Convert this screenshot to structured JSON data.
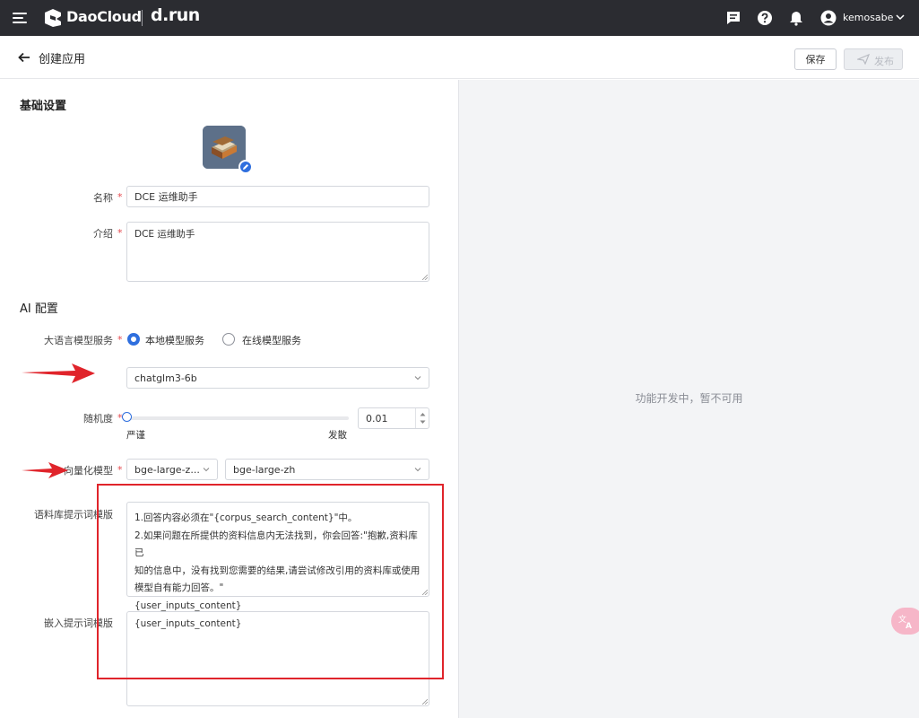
{
  "topbar": {
    "logo_text": "DaoCloud",
    "brand2": "d.run",
    "username": "kemosabe",
    "icons": [
      "menu-icon",
      "daocloud-logo-icon",
      "message-icon",
      "help-icon",
      "bell-icon",
      "user-avatar-icon",
      "chevron-down-icon"
    ]
  },
  "header": {
    "title": "创建应用",
    "save_label": "保存",
    "publish_label": "发布"
  },
  "basic": {
    "section_title": "基础设置",
    "name_label": "名称",
    "name_value": "DCE 运维助手",
    "intro_label": "介绍",
    "intro_value": "DCE 运维助手"
  },
  "ai": {
    "section_title": "AI 配置",
    "llm_label": "大语言模型服务",
    "llm_options": [
      {
        "label": "本地模型服务",
        "selected": true
      },
      {
        "label": "在线模型服务",
        "selected": false
      }
    ],
    "model_select": "chatglm3-6b",
    "temperature_label": "随机度",
    "temperature_value": "0.01",
    "temperature_min_label": "严谨",
    "temperature_max_label": "发散",
    "temperature_level": 0.01,
    "embedding_label": "向量化模型",
    "embedding_provider": "bge-large-z...",
    "embedding_model": "bge-large-zh",
    "corpus_prompt_label": "语料库提示词模版",
    "corpus_prompt_lines": [
      "1.回答内容必须在\"{corpus_search_content}\"中。",
      "2.如果问题在所提供的资料信息内无法找到，你会回答:\"抱歉,资料库已",
      "知的信息中，没有找到您需要的结果,请尝试修改引用的资料库或使用",
      "模型自有能力回答。\"",
      "{user_inputs_content}"
    ],
    "embed_prompt_label": "嵌入提示词模版",
    "embed_prompt_value": "{user_inputs_content}"
  },
  "preview": {
    "message": "功能开发中，暂不可用"
  },
  "colors": {
    "topbar_bg": "#2b2c31",
    "primary": "#2f6fde",
    "required": "#e5484d",
    "annotation_red": "#e0242b"
  }
}
